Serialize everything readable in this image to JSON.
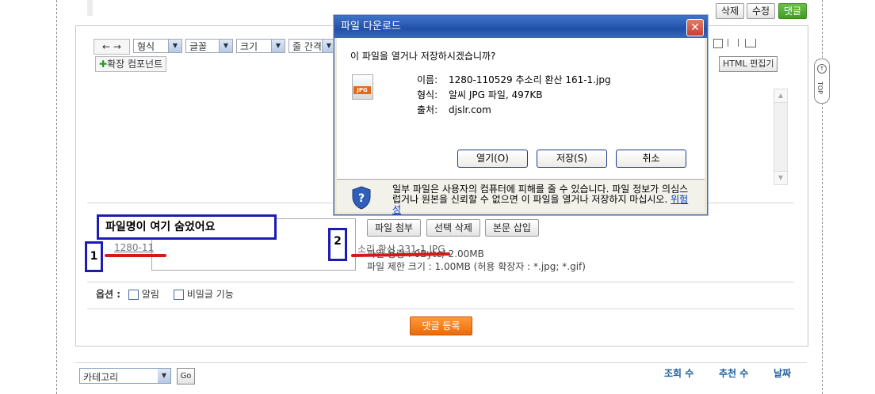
{
  "top_actions": {
    "delete": "삭제",
    "edit": "수정",
    "comment": "댓글"
  },
  "toolbar": {
    "nav": "← →",
    "selects": [
      "형식",
      "글꼴",
      "크기",
      "줄 간격"
    ],
    "ext_component": "확장 컴포넌트",
    "html_editor": "HTML 편집기"
  },
  "dialog": {
    "title": "파일 다운로드",
    "question": "이 파일을 열거나 저장하시겠습니까?",
    "name_label": "이름:",
    "name_value": "1280-110529 추소리 환산 161-1.jpg",
    "type_label": "형식:",
    "type_value": "알씨 JPG 파일, 497KB",
    "from_label": "출처:",
    "from_value": "djslr.com",
    "icon_text": "JPG",
    "open_btn": "열기(O)",
    "save_btn": "저장(S)",
    "cancel_btn": "취소",
    "warning_text": "일부 파일은 사용자의 컴퓨터에 피해를 줄 수 있습니다. 파일 정보가 의심스럽거나 원본을 신뢰할 수 없으면 이 파일을 열거나 저장하지 마십시오.",
    "danger_link": "위험성"
  },
  "attach": {
    "annotation_title": "파일명이 여기 숨었어요",
    "label_1": "1",
    "label_2": "2",
    "file_truncated": "1280-11",
    "file_overflow": "소리 환산 231-1.JPG",
    "usage_text": "파일 용량 : 0Byte/ 2.00MB",
    "limit_text": "파일 제한 크기 : 1.00MB (허용 확장자 : *.jpg; *.gif)",
    "attach_btn": "파일 첨부",
    "delete_sel_btn": "선택 삭제",
    "insert_btn": "본문 삽입"
  },
  "options": {
    "label": "옵션 :",
    "notify": "알림",
    "secret": "비밀글 기능"
  },
  "submit": "댓글 등록",
  "bottom": {
    "category": "카테고리",
    "go": "Go",
    "views": "조회 수",
    "recommend": "추천 수",
    "date": "날짜"
  },
  "side_top": "TOP",
  "colors": {
    "accent_orange": "#ea6b0c",
    "annotation_blue": "#1d1bb8",
    "annotation_red": "#d61818",
    "xp_title": "#2050a8"
  }
}
